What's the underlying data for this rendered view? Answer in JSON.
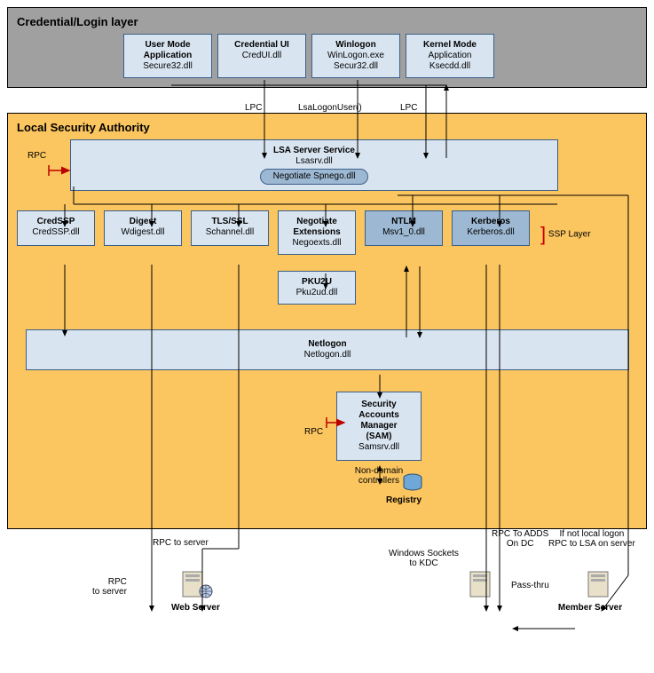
{
  "credential_layer": {
    "title": "Credential/Login layer",
    "boxes": {
      "user_mode": {
        "title": "User Mode\nApplication",
        "sub": "Secure32.dll"
      },
      "cred_ui": {
        "title": "Credential UI",
        "sub": "CredUI.dll"
      },
      "winlogon": {
        "title": "Winlogon",
        "sub": "WinLogon.exe\nSecur32.dll"
      },
      "kernel": {
        "title": "Kernel Mode",
        "sub": "Application\nKsecdd.dll"
      }
    },
    "edges": {
      "lpc_left": "LPC",
      "lsa_logon": "LsaLogonUser()",
      "lpc_right": "LPC"
    }
  },
  "lsa_layer": {
    "title": "Local Security Authority",
    "rpc_in": "RPC",
    "lsa_service": {
      "title": "LSA Server Service",
      "sub": "Lsasrv.dll",
      "negotiate": "Negotiate Spnego.dll"
    },
    "ssp": {
      "credssp": {
        "title": "CredSSP",
        "sub": "CredSSP.dll"
      },
      "digest": {
        "title": "Digest",
        "sub": "Wdigest.dll"
      },
      "tls": {
        "title": "TLS/SSL",
        "sub": "Schannel.dll"
      },
      "negext": {
        "title": "Negotiate\nExtensions",
        "sub": "Negoexts.dll"
      },
      "ntlm": {
        "title": "NTLM",
        "sub": "Msv1_0.dll"
      },
      "kerberos": {
        "title": "Kerberos",
        "sub": "Kerberos.dll"
      },
      "ssp_label": "SSP Layer"
    },
    "pku2u": {
      "title": "PKU2U",
      "sub": "Pku2ud.dll"
    },
    "netlogon": {
      "title": "Netlogon",
      "sub": "Netlogon.dll"
    },
    "sam": {
      "rpc": "RPC",
      "title": "Security\nAccounts\nManager\n(SAM)",
      "sub": "Samsrv.dll"
    },
    "registry_edge": "Non-domain\ncontrollers",
    "registry": "Registry"
  },
  "footer": {
    "rpc_to_server1": "RPC to server",
    "rpc_to_server2": "RPC\nto server",
    "web_server": "Web Server",
    "win_sockets": "Windows Sockets\nto KDC",
    "rpc_adds": "RPC To ADDS\nOn DC",
    "pass_thru": "Pass-thru",
    "not_local": "If not local logon\nRPC to LSA  on server",
    "member_server": "Member Server"
  }
}
